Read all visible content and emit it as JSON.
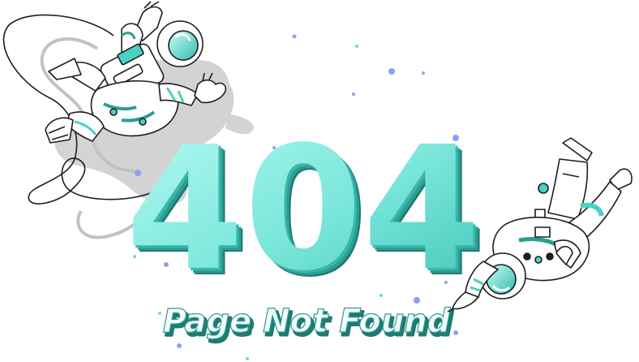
{
  "error": {
    "code": "404",
    "message": "Page Not Found"
  },
  "colors": {
    "teal_light": "#8ff0e6",
    "teal": "#49d2c4",
    "teal_dark": "#2b9e93",
    "teal_deep": "#1f7a72",
    "shadow_gray": "#c9c9c9",
    "outline": "#1d1d1d",
    "dot_blue": "#8fa0f0",
    "dot_teal": "#6fd8cc"
  },
  "illustration": {
    "left_figure": "astronaut-floating",
    "right_figure": "astronaut-upside-down"
  }
}
